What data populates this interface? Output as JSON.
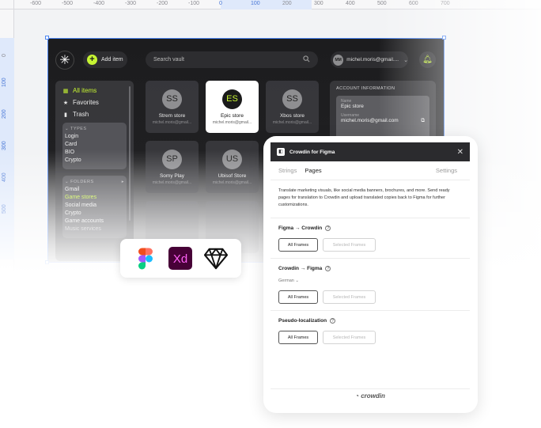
{
  "rulers": {
    "top_ticks": [
      "-600",
      "-500",
      "-400",
      "-300",
      "-200",
      "-100",
      "0",
      "100",
      "200",
      "300",
      "400",
      "500",
      "600",
      "700"
    ],
    "left_ticks": [
      "0",
      "100",
      "200",
      "300",
      "400",
      "500"
    ]
  },
  "app": {
    "add_item_label": "Add item",
    "search_placeholder": "Search vault",
    "user": {
      "initials": "MM",
      "email": "michel.moris@gmail...."
    },
    "nav": [
      {
        "label": "All items",
        "icon": "grid-icon"
      },
      {
        "label": "Favorites",
        "icon": "star-icon"
      },
      {
        "label": "Trash",
        "icon": "trash-icon"
      }
    ],
    "types": {
      "heading": "TYPES",
      "items": [
        "Login",
        "Card",
        "BIO",
        "Crypto"
      ]
    },
    "folders": {
      "heading": "FOLDERS",
      "items": [
        "Gmail",
        "Game stores",
        "Social media",
        "Crypto",
        "Game accounts",
        "Music services"
      ],
      "active": "Game stores"
    },
    "cards": [
      {
        "initials": "SS",
        "name": "Strem store",
        "email": "michel.moris@gmail..."
      },
      {
        "initials": "ES",
        "name": "Epic store",
        "email": "michel.moris@gmail..."
      },
      {
        "initials": "SS",
        "name": "Xbos store",
        "email": "michel.moris@gmail..."
      },
      {
        "initials": "SP",
        "name": "Somy Play",
        "email": "michel.moris@gmail..."
      },
      {
        "initials": "US",
        "name": "Ubisof Store",
        "email": "michel.moris@gmail..."
      }
    ],
    "account": {
      "heading": "ACCOUNT INFORMATION",
      "name_label": "Name",
      "name_value": "Epic store",
      "username_label": "Username",
      "username_value": "michel.moris@gmail.com"
    }
  },
  "tools": [
    "figma-logo-icon",
    "adobe-xd-logo-icon",
    "sketch-logo-icon"
  ],
  "tools_xd_text": "Xd",
  "plugin": {
    "title": "Crowdin for Figma",
    "tabs": {
      "strings": "Strings",
      "pages": "Pages",
      "settings": "Settings"
    },
    "description": "Translate marketing visuals, like social media banners, brochures, and more. Send ready pages for translation to Crowdin and upload translated copies back to Figma for further customizations.",
    "sections": [
      {
        "title": "Figma → Crowdin",
        "primary": "All Frames",
        "secondary": "Selected Frames"
      },
      {
        "title": "Crowdin → Figma",
        "select": "German",
        "primary": "All Frames",
        "secondary": "Selected Frames"
      },
      {
        "title": "Pseudo-localization",
        "primary": "All Frames",
        "secondary": "Selected Frames"
      }
    ],
    "footer_brand": "crowdin"
  },
  "colors": {
    "accent": "#c6f432",
    "selection": "#4b84f0",
    "dark": "#1c1c1e"
  }
}
